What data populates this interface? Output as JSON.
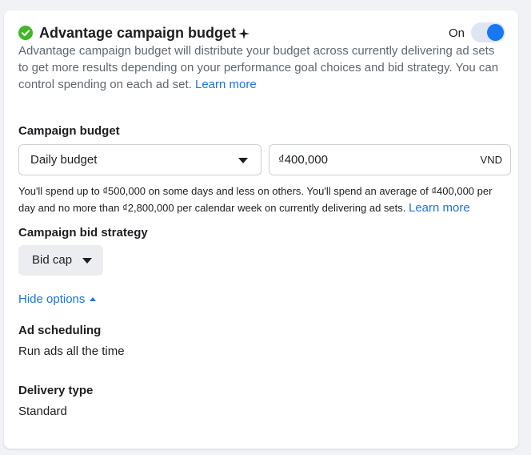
{
  "header": {
    "title": "Advantage campaign budget",
    "icon": "check-circle-icon",
    "sparkle_icon": "sparkle-plus-icon",
    "toggle_label": "On",
    "toggle_state": true,
    "accent_color": "#1877f2",
    "success_color": "#42b72a"
  },
  "description": {
    "text": "Advantage campaign budget will distribute your budget across currently delivering ad sets to get more results depending on your performance goal choices and bid strategy. You can control spending on each ad set.",
    "link": "Learn more"
  },
  "campaign_budget": {
    "label": "Campaign budget",
    "budget_type": "Daily budget",
    "amount": "₫400,000",
    "currency": "VND",
    "note": "You'll spend up to ₫500,000 on some days and less on others. You'll spend an average of ₫400,000 per day and no more than ₫2,800,000 per calendar week on currently delivering ad sets.",
    "note_link": "Learn more"
  },
  "bid_strategy": {
    "label": "Campaign bid strategy",
    "value": "Bid cap"
  },
  "options_toggle": "Hide options",
  "ad_scheduling": {
    "label": "Ad scheduling",
    "value": "Run ads all the time"
  },
  "delivery_type": {
    "label": "Delivery type",
    "value": "Standard"
  }
}
